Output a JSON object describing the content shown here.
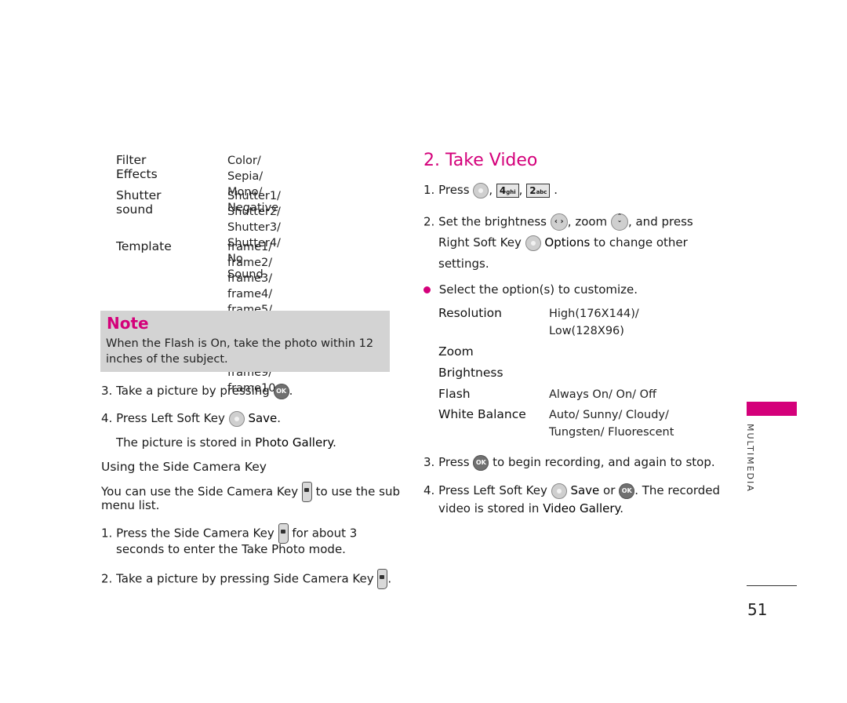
{
  "left": {
    "options": [
      {
        "label": "Filter Effects",
        "value": "Color/ Sepia/ Mono/\nNegative"
      },
      {
        "label": "Shutter sound",
        "value": "Shutter1/ Shutter2/\nShutter3/ Shutter4/\nNo Sound"
      },
      {
        "label": "Template",
        "value": "frame1/ frame2/ frame3/\nframe4/ frame5/ frame6/\nframe7/ frame8/ frame9/\nframe10"
      }
    ],
    "note": {
      "title": "Note",
      "body": "When the Flash is On, take the photo within 12 inches of the subject."
    },
    "step3": {
      "prefix": "3. Take a picture by pressing",
      "icon": "ok-key-icon",
      "suffix": "."
    },
    "step4": {
      "prefix": "4. Press Left Soft Key",
      "icon": "left-soft-key-icon",
      "bold": "Save",
      "suffix": "."
    },
    "stored": {
      "prefix": "The picture is stored in",
      "bold": "Photo Gallery",
      "suffix": "."
    },
    "side_heading": "Using the Side Camera Key",
    "side_intro": {
      "prefix": "You can use the Side Camera Key",
      "icon": "side-camera-key-icon",
      "suffix": "to use the sub",
      "line2": "menu list."
    },
    "side_step1": {
      "prefix": "1. Press the Side Camera Key",
      "icon": "side-camera-key-icon",
      "suffix": "for about 3",
      "line2": "seconds to enter the Take Photo mode."
    },
    "side_step2": {
      "prefix": "2. Take a picture by pressing Side Camera Key",
      "icon": "side-camera-key-icon",
      "suffix": "."
    }
  },
  "right": {
    "heading": "2. Take Video",
    "step1": {
      "prefix": "1. Press",
      "key1": "4",
      "key1_sub": "ghi",
      "key2": "2",
      "key2_sub": "abc"
    },
    "step2": {
      "p1": "2. Set the brightness",
      "p2": ", zoom",
      "p3": ", and press",
      "line2_prefix": "Right Soft Key",
      "line2_bold": "Options",
      "line2_suffix": "to change other",
      "line3": "settings."
    },
    "bullet": "Select the option(s) to customize.",
    "options": [
      {
        "label": "Resolution",
        "value": "High(176X144)/\nLow(128X96)"
      },
      {
        "label": "Zoom",
        "value": ""
      },
      {
        "label": "Brightness",
        "value": ""
      },
      {
        "label": "Flash",
        "value": "Always On/ On/ Off"
      },
      {
        "label": "White Balance",
        "value": "Auto/ Sunny/ Cloudy/\nTungsten/ Fluorescent"
      }
    ],
    "step3": {
      "prefix": "3. Press",
      "suffix": "to begin recording, and again to stop."
    },
    "step4": {
      "prefix": "4. Press Left Soft Key",
      "bold": "Save",
      "mid": "or",
      "suffix": ". The recorded",
      "line2_prefix": "video is stored in",
      "line2_bold": "Video Gallery",
      "line2_suffix": "."
    }
  },
  "sidebar": {
    "section": "MULTIMEDIA",
    "page_number": "51"
  },
  "colors": {
    "accent": "#d4007a",
    "note_bg": "#d3d3d3"
  },
  "icons": {
    "ok": "OK"
  }
}
